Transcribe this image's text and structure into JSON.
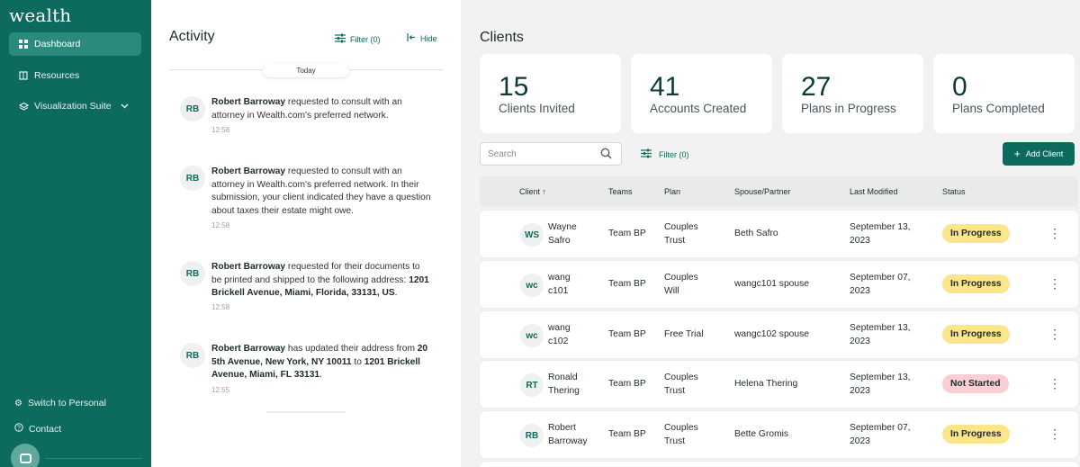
{
  "sidebar": {
    "logo": "wealth",
    "nav": [
      {
        "label": "Dashboard",
        "icon": "grid-icon",
        "active": true
      },
      {
        "label": "Resources",
        "icon": "book-icon"
      },
      {
        "label": "Visualization Suite",
        "icon": "layers-icon",
        "has_dropdown": true
      }
    ],
    "bottom": [
      {
        "label": "Switch to Personal",
        "icon": "gear-icon"
      },
      {
        "label": "Contact",
        "icon": "help-icon"
      }
    ],
    "accent": "#0d6b5e"
  },
  "activity": {
    "title": "Activity",
    "filter_label": "Filter (0)",
    "hide_label": "Hide",
    "divider_label": "Today",
    "entries": [
      {
        "initials": "RB",
        "name": "Robert Barroway",
        "text": " requested to consult with an attorney in Wealth.com's preferred network.",
        "time": "12:58"
      },
      {
        "initials": "RB",
        "name": "Robert Barroway",
        "text": " requested to consult with an attorney in Wealth.com's preferred network. In their submission, your client indicated they have a question about taxes their estate might owe.",
        "time": "12:58"
      },
      {
        "initials": "RB",
        "name": "Robert Barroway",
        "text": " requested for their documents to be printed and shipped to the following address: ",
        "bold_tail": "1201 Brickell Avenue, Miami, Florida, 33131, US",
        "tail_end": ".",
        "time": "12:58"
      },
      {
        "initials": "RB",
        "name": "Robert Barroway",
        "text": " has updated their address from ",
        "bold_mid": "20 5th Avenue, New York, NY 10011",
        "mid_text": " to ",
        "bold_tail": "1201 Brickell Avenue, Miami, FL 33131",
        "tail_end": ".",
        "time": "12:55"
      }
    ]
  },
  "clients": {
    "title": "Clients",
    "stats": [
      {
        "value": "15",
        "label": "Clients Invited"
      },
      {
        "value": "41",
        "label": "Accounts Created"
      },
      {
        "value": "27",
        "label": "Plans in Progress"
      },
      {
        "value": "0",
        "label": "Plans Completed"
      }
    ],
    "search_placeholder": "Search",
    "filter_label": "Filter (0)",
    "add_button": "Add Client",
    "columns": [
      "Client",
      "Teams",
      "Plan",
      "Spouse/Partner",
      "Last Modified",
      "Status"
    ],
    "rows": [
      {
        "initials": "WS",
        "name1": "Wayne",
        "name2": "Safro",
        "team": "Team BP",
        "plan1": "Couples",
        "plan2": "Trust",
        "spouse": "Beth Safro",
        "date1": "September 13,",
        "date2": "2023",
        "status": "In Progress",
        "status_type": "progress"
      },
      {
        "initials": "wc",
        "name1": "wang",
        "name2": "c101",
        "team": "Team BP",
        "plan1": "Couples",
        "plan2": "Will",
        "spouse": "wangc101 spouse",
        "date1": "September 07,",
        "date2": "2023",
        "status": "In Progress",
        "status_type": "progress"
      },
      {
        "initials": "wc",
        "name1": "wang",
        "name2": "c102",
        "team": "Team BP",
        "plan1": "Free Trial",
        "plan2": "",
        "spouse": "wangc102 spouse",
        "date1": "September 13,",
        "date2": "2023",
        "status": "In Progress",
        "status_type": "progress"
      },
      {
        "initials": "RT",
        "name1": "Ronald",
        "name2": "Thering",
        "team": "Team BP",
        "plan1": "Couples",
        "plan2": "Trust",
        "spouse": "Helena Thering",
        "date1": "September 13,",
        "date2": "2023",
        "status": "Not Started",
        "status_type": "notstarted"
      },
      {
        "initials": "RB",
        "name1": "Robert",
        "name2": "Barroway",
        "team": "Team BP",
        "plan1": "Couples",
        "plan2": "Trust",
        "spouse": "Bette Gromis",
        "date1": "September 07,",
        "date2": "2023",
        "status": "In Progress",
        "status_type": "progress"
      }
    ],
    "status_colors": {
      "progress": "#fde58a",
      "notstarted": "#f9cfd5"
    }
  }
}
